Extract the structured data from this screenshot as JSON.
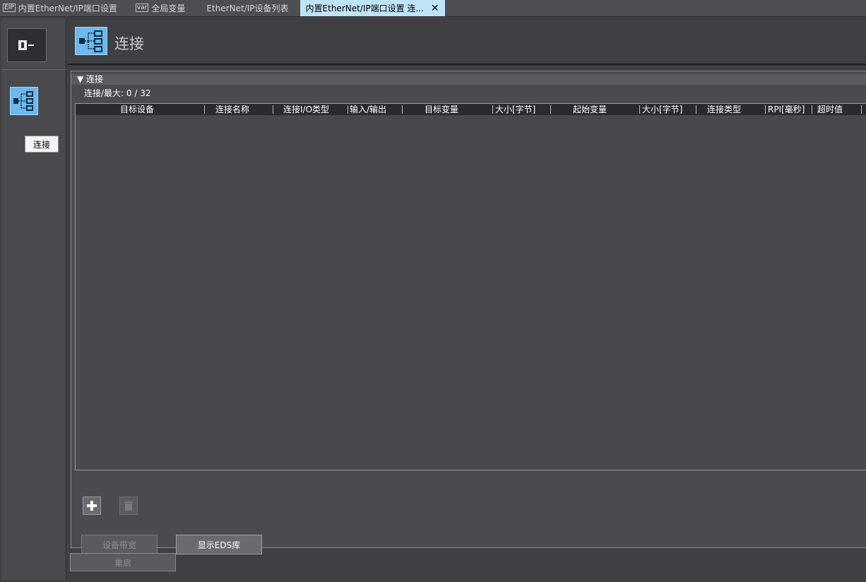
{
  "tabs": [
    {
      "icon": "EIP",
      "label": "内置EtherNet/IP端口设置",
      "active": false
    },
    {
      "icon": "var",
      "label": "全局变量",
      "active": false
    },
    {
      "icon": "",
      "label": "EtherNet/IP设备列表",
      "active": false
    },
    {
      "icon": "",
      "label": "内置EtherNet/IP端口设置 连...",
      "active": true
    }
  ],
  "header": {
    "title": "连接"
  },
  "sidebar": {
    "tooltip": "连接"
  },
  "panel": {
    "section_title": "▼ 连接",
    "count_label": "连接/最大: 0 / 32"
  },
  "table": {
    "columns": [
      "目标设备",
      "连接名称",
      "连接I/O类型",
      "输入/输出",
      "目标变量",
      "大小[字节]",
      "起始变量",
      "大小[字节]",
      "连接类型",
      "RPI[毫秒]",
      "超时值"
    ]
  },
  "buttons": {
    "bandwidth": "设备带宽",
    "eds": "显示EDS库",
    "restart": "重启"
  },
  "colors": {
    "accent": "#6db8ec",
    "active_tab": "#bfe3f7",
    "background": "#3f3f44"
  }
}
